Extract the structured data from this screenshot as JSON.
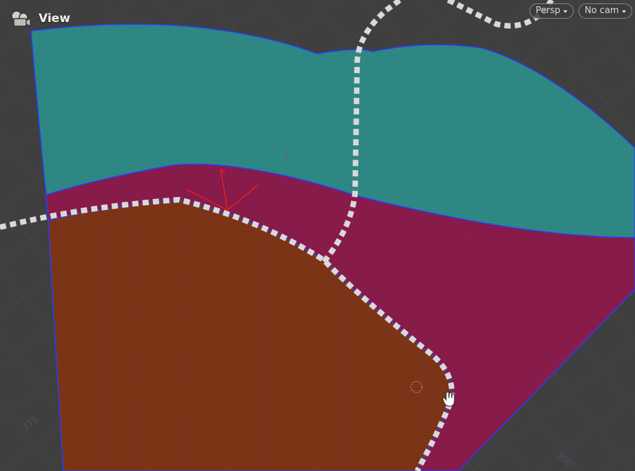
{
  "viewport": {
    "title": "View",
    "projection_label": "Persp",
    "camera_label": "No cam",
    "grid_labels": {
      "bottom_left": "375",
      "bottom_right": "300"
    },
    "colors": {
      "background": "#3f3f3f",
      "teal_region": "#2f8a86",
      "magenta_region": "#8a1c4c",
      "orange_region": "#7e3517",
      "boundary": "#2b3cff",
      "red_guides": "#ff1a1a",
      "road": "#d9d9d9"
    },
    "icons": [
      "view-icon",
      "hand-cursor-icon",
      "pivot-handle-icon"
    ]
  }
}
